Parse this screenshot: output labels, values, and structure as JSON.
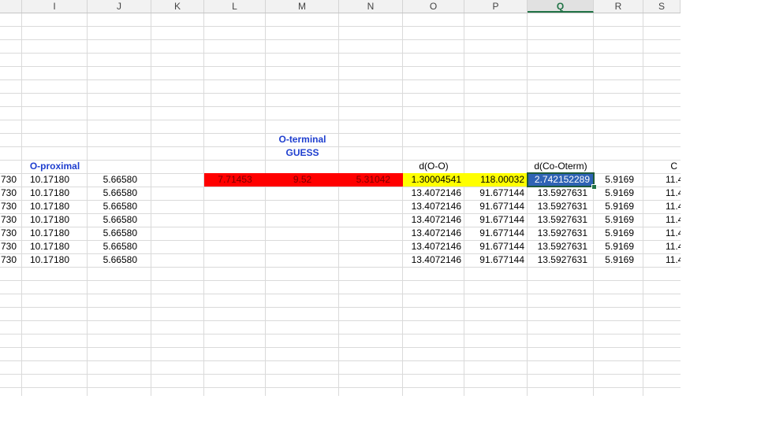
{
  "columns": [
    "I",
    "J",
    "K",
    "L",
    "M",
    "N",
    "O",
    "P",
    "Q",
    "R",
    "S"
  ],
  "selected_column": "Q",
  "headers": {
    "o_terminal_line1": "O-terminal",
    "o_terminal_line2": "GUESS",
    "o_proximal": "O-proximal",
    "d_oo": "d(O-O)",
    "d_co_oterm": "d(Co-Oterm)",
    "s_partial": "C"
  },
  "guess_row": {
    "h_partial": "730",
    "i": "10.17180",
    "j": "5.66580",
    "l": "7.71453",
    "m": "9.52",
    "n": "5.31042",
    "o": "1.30004541",
    "p": "118.00032",
    "q": "2.742152289",
    "r": "5.9169",
    "s_partial": "11.4"
  },
  "data_rows": [
    {
      "h_partial": "730",
      "i": "10.17180",
      "j": "5.66580",
      "o": "13.4072146",
      "p": "91.677144",
      "q": "13.5927631",
      "r": "5.9169",
      "s_partial": "11.4"
    },
    {
      "h_partial": "730",
      "i": "10.17180",
      "j": "5.66580",
      "o": "13.4072146",
      "p": "91.677144",
      "q": "13.5927631",
      "r": "5.9169",
      "s_partial": "11.4"
    },
    {
      "h_partial": "730",
      "i": "10.17180",
      "j": "5.66580",
      "o": "13.4072146",
      "p": "91.677144",
      "q": "13.5927631",
      "r": "5.9169",
      "s_partial": "11.4"
    },
    {
      "h_partial": "730",
      "i": "10.17180",
      "j": "5.66580",
      "o": "13.4072146",
      "p": "91.677144",
      "q": "13.5927631",
      "r": "5.9169",
      "s_partial": "11.4"
    },
    {
      "h_partial": "730",
      "i": "10.17180",
      "j": "5.66580",
      "o": "13.4072146",
      "p": "91.677144",
      "q": "13.5927631",
      "r": "5.9169",
      "s_partial": "11.4"
    },
    {
      "h_partial": "730",
      "i": "10.17180",
      "j": "5.66580",
      "o": "13.4072146",
      "p": "91.677144",
      "q": "13.5927631",
      "r": "5.9169",
      "s_partial": "11.4"
    }
  ],
  "colors": {
    "red_fill": "#ff0000",
    "yellow_fill": "#ffff00",
    "selected_fill": "#2f63b5",
    "header_blue": "#1f3fcf",
    "excel_green": "#217346"
  }
}
